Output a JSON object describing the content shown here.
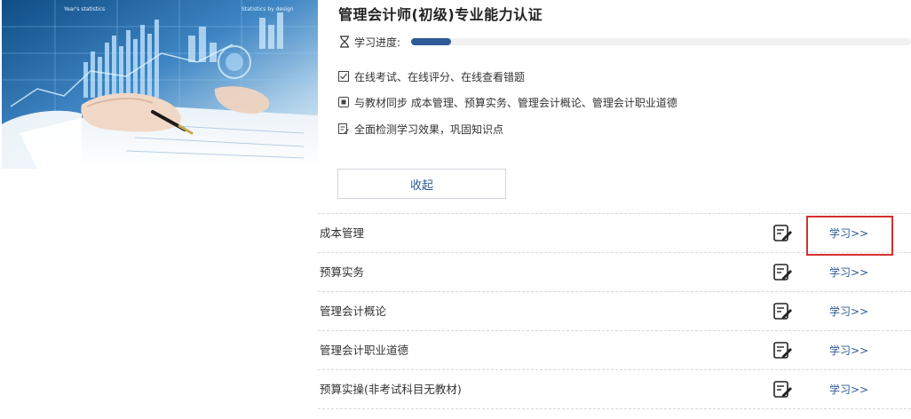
{
  "course": {
    "title": "管理会计师(初级)专业能力认证",
    "progress_label": "学习进度:",
    "progress_fraction": 0.08
  },
  "hero": {
    "chart_caption_left": "Year's statistics",
    "chart_caption_right": "Statistics by design"
  },
  "features": [
    {
      "icon": "checkbox-icon",
      "text": "在线考试、在线评分、在线查看错题"
    },
    {
      "icon": "book-icon",
      "text": "与教材同步 成本管理、预算实务、管理会计概论、管理会计职业道德"
    },
    {
      "icon": "notepad-icon",
      "text": "全面检测学习效果，巩固知识点"
    }
  ],
  "collapse_label": "收起",
  "chapters": [
    {
      "name": "成本管理",
      "link": "学习>>"
    },
    {
      "name": "预算实务",
      "link": "学习>>"
    },
    {
      "name": "管理会计概论",
      "link": "学习>>"
    },
    {
      "name": "管理会计职业道德",
      "link": "学习>>"
    },
    {
      "name": "预算实操(非考试科目无教材)",
      "link": "学习>>"
    }
  ],
  "colors": {
    "accent": "#2c5a95",
    "progress": "#2f5c97",
    "highlight": "#d63030"
  }
}
